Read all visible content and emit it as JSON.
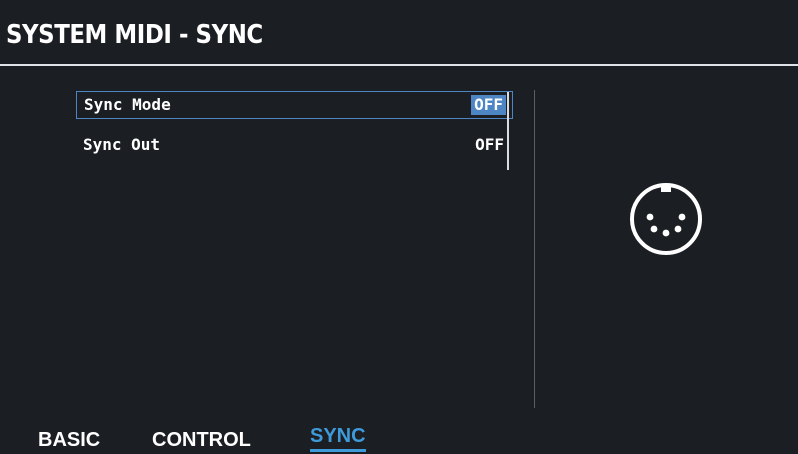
{
  "header": {
    "title": "SYSTEM MIDI - SYNC"
  },
  "params": [
    {
      "label": "Sync Mode",
      "value": "OFF",
      "selected": true
    },
    {
      "label": "Sync Out",
      "value": "OFF",
      "selected": false
    }
  ],
  "preview": {
    "icon": "midi-din-connector-icon"
  },
  "tabs": [
    {
      "label": "BASIC",
      "active": false
    },
    {
      "label": "CONTROL",
      "active": false
    },
    {
      "label": "SYNC",
      "active": true
    }
  ],
  "colors": {
    "background": "#1b1e23",
    "accent": "#4e86c4",
    "active_tab": "#3e9ad9",
    "text": "#ffffff"
  }
}
